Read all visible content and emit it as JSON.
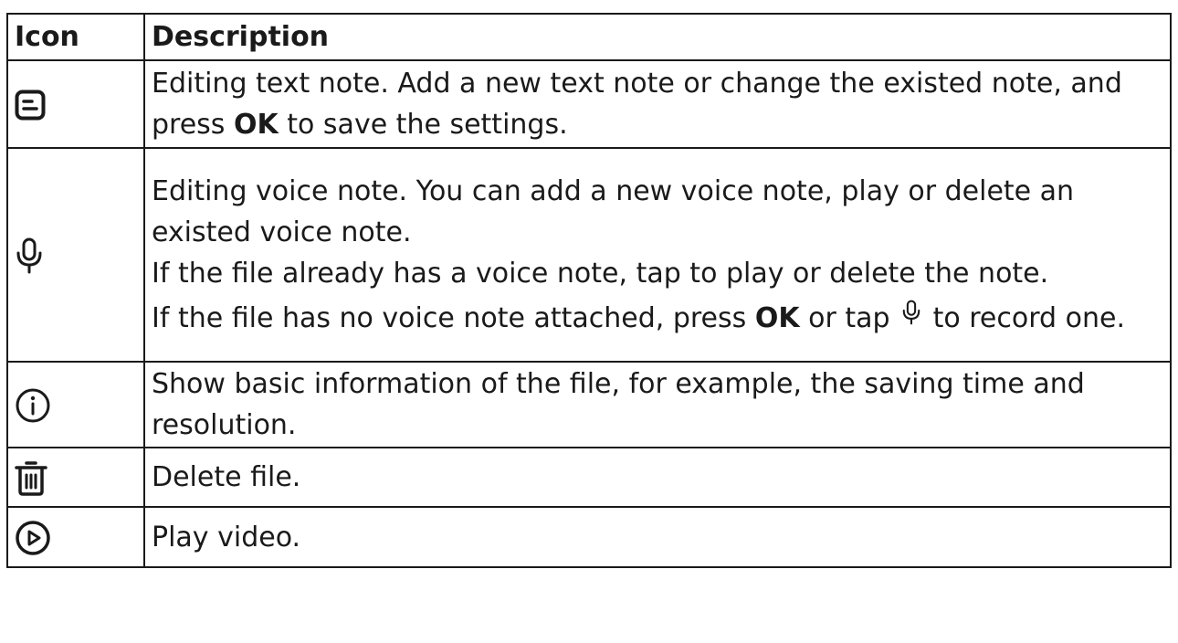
{
  "table": {
    "headers": {
      "icon": "Icon",
      "description": "Description"
    },
    "rows": [
      {
        "icon": "text-note-icon",
        "desc": {
          "pre": "Editing text note. Add a new text note or change the existed note, and press ",
          "bold": "OK",
          "post": " to save the settings."
        }
      },
      {
        "icon": "microphone-icon",
        "desc": {
          "p1": "Editing voice note. You can add a new voice note, play or delete an existed voice note.",
          "p2": "If the file already has a voice note, tap to play or delete the note.",
          "p3_pre": "If the file has no voice note attached, press ",
          "p3_bold": "OK",
          "p3_mid": " or tap ",
          "p3_icon": "microphone-icon",
          "p3_post": " to record one."
        }
      },
      {
        "icon": "info-icon",
        "desc": {
          "text": "Show basic information of the file, for example, the saving time and resolution."
        }
      },
      {
        "icon": "trash-icon",
        "desc": {
          "text": "Delete file."
        }
      },
      {
        "icon": "play-circle-icon",
        "desc": {
          "text": "Play video."
        }
      }
    ]
  }
}
